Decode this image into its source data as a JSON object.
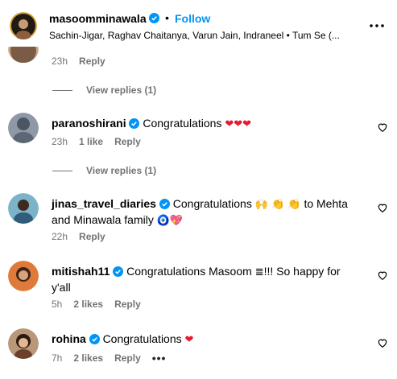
{
  "header": {
    "username": "masoomminawala",
    "follow_label": "Follow",
    "audio": "Sachin-Jigar, Raghav Chaitanya, Varun Jain, Indraneel • Tum Se (..."
  },
  "comments_top": {
    "time": "23h",
    "reply_label": "Reply",
    "view_replies": "View replies (1)"
  },
  "comments": [
    {
      "username": "paranoshirani",
      "text": "Congratulations",
      "emoji": "❤❤❤",
      "time": "23h",
      "likes": "1 like",
      "reply_label": "Reply",
      "view_replies": "View replies (1)"
    },
    {
      "username": "jinas_travel_diaries",
      "text": "Congratulations",
      "emoji1": "🙌 👏 👏",
      "text2": "to Mehta and Minawala family",
      "emoji2": "🧿💖",
      "time": "22h",
      "reply_label": "Reply"
    },
    {
      "username": "mitishah11",
      "text": "Congratulations Masoom",
      "emoji": "≣",
      "text2": "!!! So happy for y'all",
      "time": "5h",
      "likes": "2 likes",
      "reply_label": "Reply"
    },
    {
      "username": "rohina",
      "text": "Congratulations",
      "emoji": "❤",
      "time": "7h",
      "likes": "2 likes",
      "reply_label": "Reply"
    }
  ],
  "colors": {
    "link_blue": "#0095f6",
    "meta_gray": "#737373",
    "verified_blue": "#0095f6",
    "heart_red": "#e8192c"
  }
}
